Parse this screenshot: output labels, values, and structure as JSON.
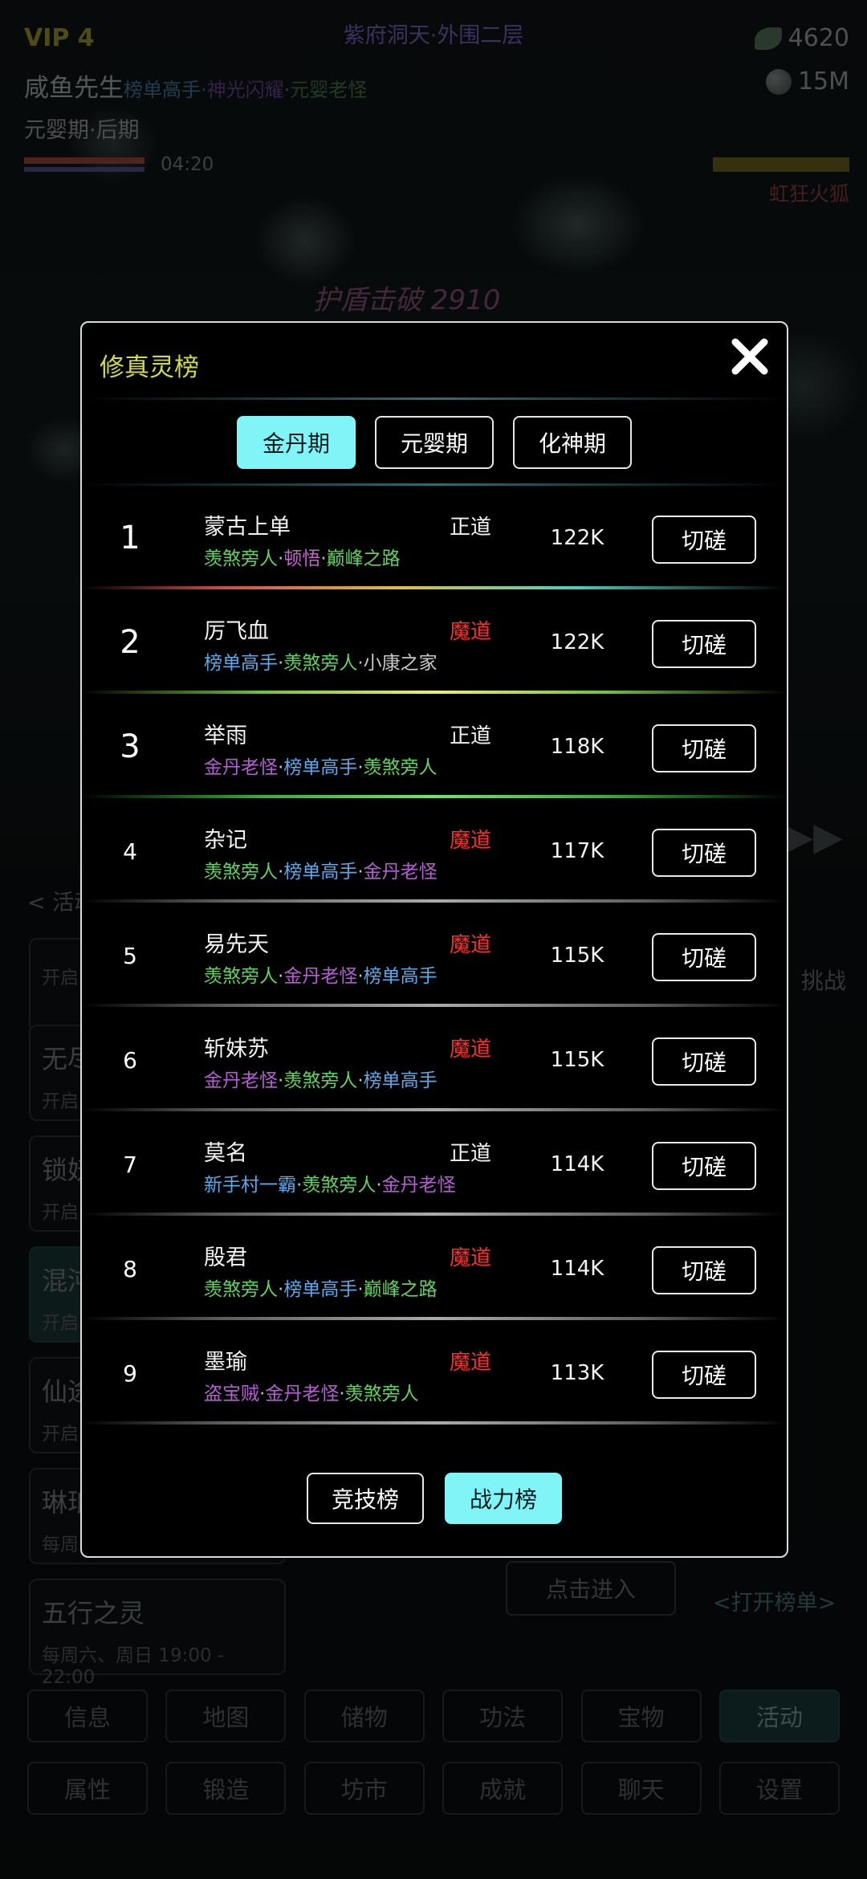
{
  "header": {
    "vip": "VIP 4",
    "map_title": "紫府洞天·外围二层",
    "spirit_count": "4620",
    "stone_count": "15M",
    "player_name": "咸鱼先生",
    "player_titles": [
      "榜单高手",
      "神光闪耀",
      "元婴老怪"
    ],
    "realm": "元婴期·后期",
    "timer": "04:20",
    "enemy_name": "虹狂火狐",
    "float_text": "护盾击破 2910"
  },
  "background": {
    "activity_header": "< 活动",
    "side_text": "挑战",
    "activities": [
      {
        "title": "",
        "sub": "开启"
      },
      {
        "title": "无尽",
        "sub": "开启"
      },
      {
        "title": "锁妖",
        "sub": "开启"
      },
      {
        "title": "混沌",
        "sub": "开启"
      },
      {
        "title": "仙途",
        "sub": "开启"
      },
      {
        "title": "琳琅",
        "sub": "每周"
      },
      {
        "title": "五行之灵",
        "sub": "每周六、周日 19:00 - 22:00"
      }
    ],
    "enter_button": "点击进入",
    "open_rank": "<打开榜单>",
    "nav_row1": [
      "信息",
      "地图",
      "储物",
      "功法",
      "宝物",
      "活动"
    ],
    "nav_row2": [
      "属性",
      "锻造",
      "坊市",
      "成就",
      "聊天",
      "设置"
    ],
    "nav_active": "活动"
  },
  "modal": {
    "title": "修真灵榜",
    "realm_tabs": [
      "金丹期",
      "元婴期",
      "化神期"
    ],
    "active_realm_tab": 0,
    "spar_label": "切磋",
    "bottom_tabs": [
      "竞技榜",
      "战力榜"
    ],
    "active_bottom_tab": 1,
    "rankings": [
      {
        "rank": "1",
        "name": "蒙古上单",
        "alignment": "正道",
        "power": "122K",
        "titles": [
          {
            "t": "羡煞旁人",
            "c": "#5fd35f"
          },
          {
            "t": "顿悟",
            "c": "#c95fd1"
          },
          {
            "t": "巅峰之路",
            "c": "#5fd35f"
          }
        ]
      },
      {
        "rank": "2",
        "name": "厉飞血",
        "alignment": "魔道",
        "power": "122K",
        "titles": [
          {
            "t": "榜单高手",
            "c": "#5aa9e8"
          },
          {
            "t": "羡煞旁人",
            "c": "#5fd35f"
          },
          {
            "t": "小康之家",
            "c": "#c9c9c9"
          }
        ]
      },
      {
        "rank": "3",
        "name": "举雨",
        "alignment": "正道",
        "power": "118K",
        "titles": [
          {
            "t": "金丹老怪",
            "c": "#b45fd1"
          },
          {
            "t": "榜单高手",
            "c": "#5aa9e8"
          },
          {
            "t": "羡煞旁人",
            "c": "#5fd35f"
          }
        ]
      },
      {
        "rank": "4",
        "name": "杂记",
        "alignment": "魔道",
        "power": "117K",
        "titles": [
          {
            "t": "羡煞旁人",
            "c": "#5fd35f"
          },
          {
            "t": "榜单高手",
            "c": "#5aa9e8"
          },
          {
            "t": "金丹老怪",
            "c": "#b45fd1"
          }
        ]
      },
      {
        "rank": "5",
        "name": "易先天",
        "alignment": "魔道",
        "power": "115K",
        "titles": [
          {
            "t": "羡煞旁人",
            "c": "#5fd35f"
          },
          {
            "t": "金丹老怪",
            "c": "#b45fd1"
          },
          {
            "t": "榜单高手",
            "c": "#5aa9e8"
          }
        ]
      },
      {
        "rank": "6",
        "name": "斩妹苏",
        "alignment": "魔道",
        "power": "115K",
        "titles": [
          {
            "t": "金丹老怪",
            "c": "#b45fd1"
          },
          {
            "t": "羡煞旁人",
            "c": "#5fd35f"
          },
          {
            "t": "榜单高手",
            "c": "#5aa9e8"
          }
        ]
      },
      {
        "rank": "7",
        "name": "莫名",
        "alignment": "正道",
        "power": "114K",
        "titles": [
          {
            "t": "新手村一霸",
            "c": "#5aa9e8"
          },
          {
            "t": "羡煞旁人",
            "c": "#5fd35f"
          },
          {
            "t": "金丹老怪",
            "c": "#b45fd1"
          }
        ]
      },
      {
        "rank": "8",
        "name": "殷君",
        "alignment": "魔道",
        "power": "114K",
        "titles": [
          {
            "t": "羡煞旁人",
            "c": "#5fd35f"
          },
          {
            "t": "榜单高手",
            "c": "#5aa9e8"
          },
          {
            "t": "巅峰之路",
            "c": "#5fd35f"
          }
        ]
      },
      {
        "rank": "9",
        "name": "墨瑜",
        "alignment": "魔道",
        "power": "113K",
        "titles": [
          {
            "t": "盗宝贼",
            "c": "#b45fd1"
          },
          {
            "t": "金丹老怪",
            "c": "#b45fd1"
          },
          {
            "t": "羡煞旁人",
            "c": "#5fd35f"
          }
        ]
      }
    ]
  },
  "colors": {
    "accent_cyan": "#7ff5f7",
    "righteous": "#f2f2f2",
    "demonic": "#ff2a2a",
    "title_yellow": "#d4dc3c"
  }
}
